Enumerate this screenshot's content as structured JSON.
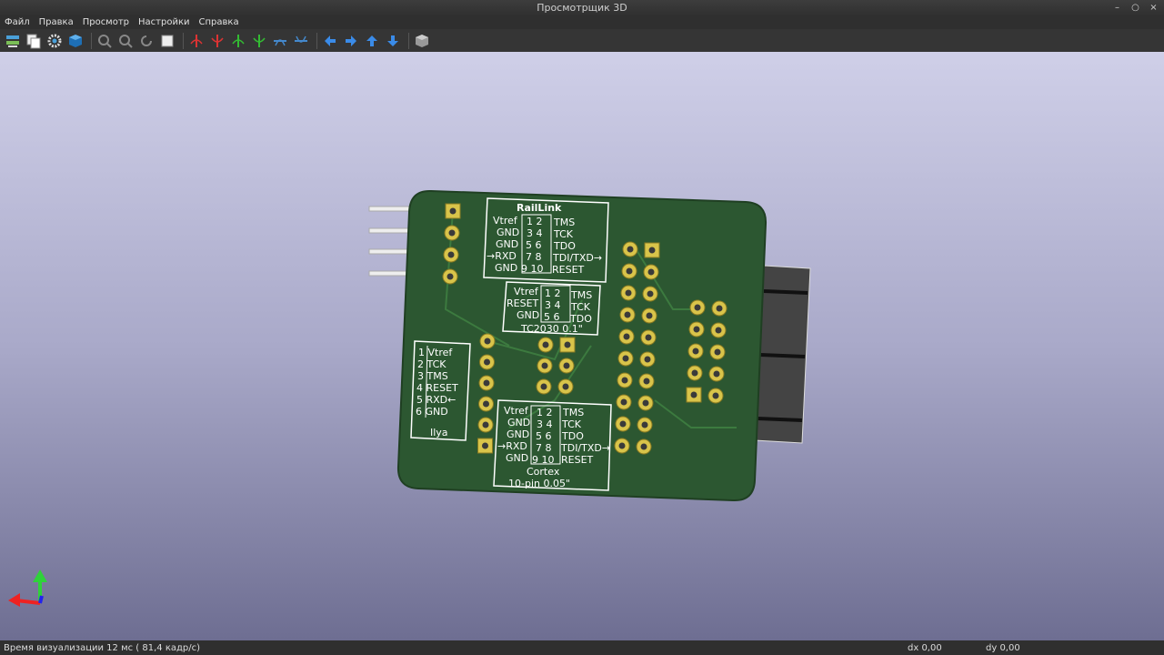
{
  "window": {
    "title": "Просмотрщик 3D"
  },
  "menu": [
    "Файл",
    "Правка",
    "Просмотр",
    "Настройки",
    "Справка"
  ],
  "toolbar": {
    "buttons": [
      "render-settings-icon",
      "copy-image-icon",
      "preferences-gear-icon",
      "raytrace-cube-icon",
      "zoom-in-icon",
      "zoom-out-icon",
      "redraw-icon",
      "zoom-fit-icon",
      "rotate-x-cw-icon",
      "rotate-x-ccw-icon",
      "rotate-y-cw-icon",
      "rotate-y-ccw-icon",
      "rotate-z-cw-icon",
      "rotate-z-ccw-icon",
      "arrow-left-icon",
      "arrow-right-icon",
      "arrow-up-icon",
      "arrow-down-icon",
      "ortho-cube-icon"
    ]
  },
  "pcb": {
    "raillink": {
      "title": "RailLink",
      "left": [
        "Vtref",
        "GND",
        "GND",
        "→RXD",
        "GND"
      ],
      "pins": [
        "1 2",
        "3 4",
        "5 6",
        "7 8",
        "9 10"
      ],
      "right": [
        "TMS",
        "TCK",
        "TDO",
        "TDI/TXD→",
        "RESET"
      ]
    },
    "tc2030": {
      "caption": "TC2030 0.1\"",
      "left": [
        "Vtref",
        "RESET",
        "GND"
      ],
      "pins": [
        "1 2",
        "3 4",
        "5 6"
      ],
      "right": [
        "TMS",
        "TCK",
        "TDO"
      ]
    },
    "ilya": {
      "caption": "Ilya",
      "rows": [
        "1 Vtref",
        "2 TCK",
        "3 TMS",
        "4 RESET",
        "5 RXD←",
        "6 GND"
      ]
    },
    "cortex": {
      "caption1": "Cortex",
      "caption2": "10-pin 0.05\"",
      "left": [
        "Vtref",
        "GND",
        "GND",
        "→RXD",
        "GND"
      ],
      "pins": [
        "1 2",
        "3 4",
        "5 6",
        "7 8",
        "9 10"
      ],
      "right": [
        "TMS",
        "TCK",
        "TDO",
        "TDI/TXD→",
        "RESET"
      ]
    }
  },
  "status": {
    "render_time": "Время визуализации 12 мс ( 81,4 кадр/с)",
    "dx": "dx 0,00",
    "dy": "dy 0,00"
  }
}
